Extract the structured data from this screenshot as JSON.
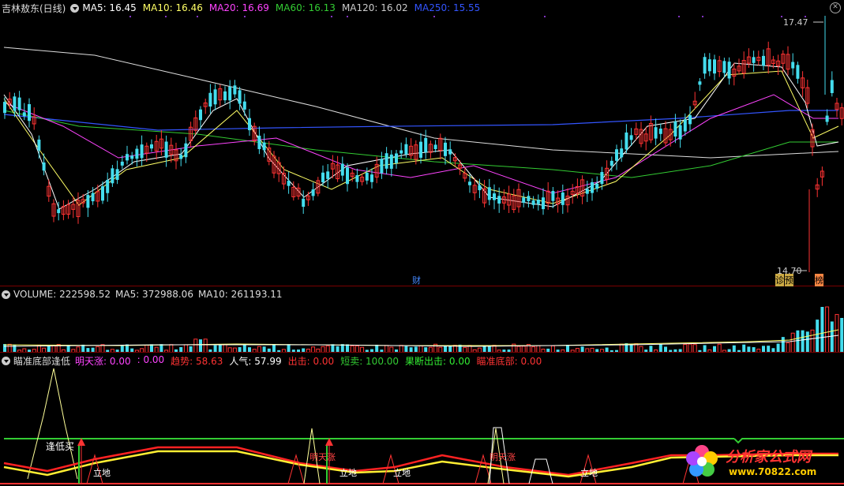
{
  "price_panel": {
    "stock_name": "吉林敖东(日线)",
    "ma": [
      {
        "label": "MA5: 16.45",
        "color": "#ffffff"
      },
      {
        "label": "MA10: 16.46",
        "color": "#ffff66"
      },
      {
        "label": "MA20: 16.69",
        "color": "#ff44ff"
      },
      {
        "label": "MA60: 16.13",
        "color": "#33cc33"
      },
      {
        "label": "MA120: 16.02",
        "color": "#cccccc"
      },
      {
        "label": "MA250: 15.55",
        "color": "#3355ff"
      }
    ],
    "high_label": "17.47",
    "low_label": "14.70",
    "markers": [
      "财",
      "诊",
      "预",
      "榜"
    ]
  },
  "volume_panel": {
    "label": "VOLUME: 222598.52",
    "ma5": "MA5: 372988.06",
    "ma10": "MA10: 261193.11"
  },
  "indicator_panel": {
    "name": "瞄准底部逢低",
    "fields": [
      {
        "label": "明天涨: 0.00",
        "color": "#ff44ff"
      },
      {
        "label": ": 0.00",
        "color": "#ff44ff"
      },
      {
        "label": "趋势: 58.63",
        "color": "#ff3333"
      },
      {
        "label": "人气: 57.99",
        "color": "#ffffff"
      },
      {
        "label": "出击: 0.00",
        "color": "#ff3333"
      },
      {
        "label": "短卖: 100.00",
        "color": "#33cc33"
      },
      {
        "label": "果断出击: 0.00",
        "color": "#33ee33"
      },
      {
        "label": "瞄准底部: 0.00",
        "color": "#ff3333"
      }
    ],
    "annotations": {
      "buy_low": "逢低买",
      "stand1": "立地",
      "stand2": "立地",
      "stand3": "立地",
      "stand4": "立地",
      "tomorrow_up1": "明天涨",
      "tomorrow_up2": "明天涨"
    }
  },
  "watermark": {
    "text": "分析家公式网",
    "url": "www.70822.com"
  }
}
